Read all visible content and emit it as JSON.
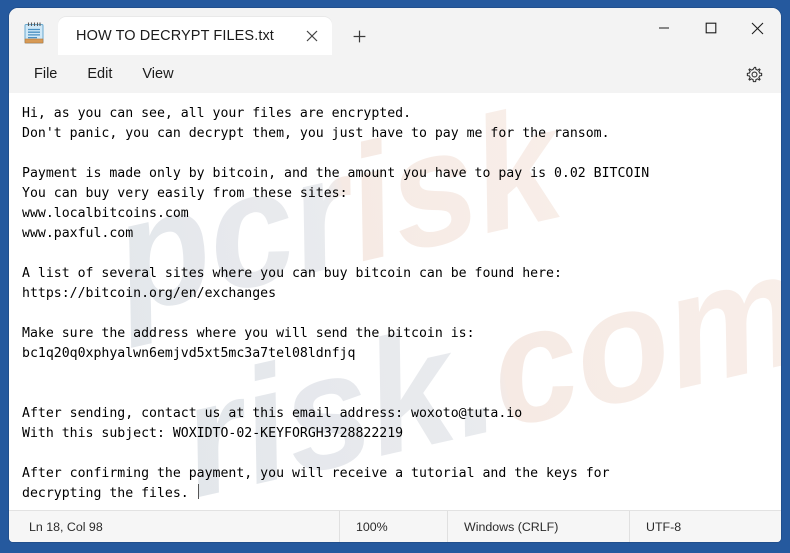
{
  "window": {
    "app_icon": "notepad-icon",
    "minimize_label": "—",
    "maximize_label": "☐",
    "close_label": "✕"
  },
  "tab": {
    "title": "HOW TO DECRYPT FILES.txt",
    "close_label": "✕",
    "newtab_label": "+"
  },
  "menubar": {
    "items": [
      {
        "label": "File"
      },
      {
        "label": "Edit"
      },
      {
        "label": "View"
      }
    ],
    "settings_icon": "gear-icon"
  },
  "editor": {
    "watermark_text": "pcrisk.com",
    "lines": [
      "Hi, as you can see, all your files are encrypted.",
      "Don't panic, you can decrypt them, you just have to pay me for the ransom.",
      "",
      "Payment is made only by bitcoin, and the amount you have to pay is 0.02 BITCOIN",
      "You can buy very easily from these sites:",
      "www.localbitcoins.com",
      "www.paxful.com",
      "",
      "A list of several sites where you can buy bitcoin can be found here:",
      "https://bitcoin.org/en/exchanges",
      "",
      "Make sure the address where you will send the bitcoin is:",
      "bc1q20q0xphyalwn6emjvd5xt5mc3a7tel08ldnfjq",
      "",
      "",
      "After sending, contact us at this email address: woxoto@tuta.io",
      "With this subject: WOXIDTO-02-KEYFORGH3728822219",
      "",
      "After confirming the payment, you will receive a tutorial and the keys for",
      "decrypting the files. "
    ],
    "full_text": "Hi, as you can see, all your files are encrypted.\nDon't panic, you can decrypt them, you just have to pay me for the ransom.\n\nPayment is made only by bitcoin, and the amount you have to pay is 0.02 BITCOIN\nYou can buy very easily from these sites:\nwww.localbitcoins.com\nwww.paxful.com\n\nA list of several sites where you can buy bitcoin can be found here:\nhttps://bitcoin.org/en/exchanges\n\nMake sure the address where you will send the bitcoin is:\nbc1q20q0xphyalwn6emjvd5xt5mc3a7tel08ldnfjq\n\n\nAfter sending, contact us at this email address: woxoto@tuta.io\nWith this subject: WOXIDTO-02-KEYFORGH3728822219\n\nAfter confirming the payment, you will receive a tutorial and the keys for\ndecrypting the files. ",
    "bitcoin_amount": "0.02 BITCOIN",
    "bitcoin_address": "bc1q20q0xphyalwn6emjvd5xt5mc3a7tel08ldnfjq",
    "contact_email": "woxoto@tuta.io",
    "email_subject": "WOXIDTO-02-KEYFORGH3728822219"
  },
  "statusbar": {
    "position": "Ln 18, Col 98",
    "zoom": "100%",
    "line_endings": "Windows (CRLF)",
    "encoding": "UTF-8"
  },
  "colors": {
    "desktop": "#25599e",
    "window_chrome": "#f3f3f3",
    "editor_bg": "#ffffff",
    "text": "#000000",
    "statusbar_bg": "#f6f6f6"
  }
}
